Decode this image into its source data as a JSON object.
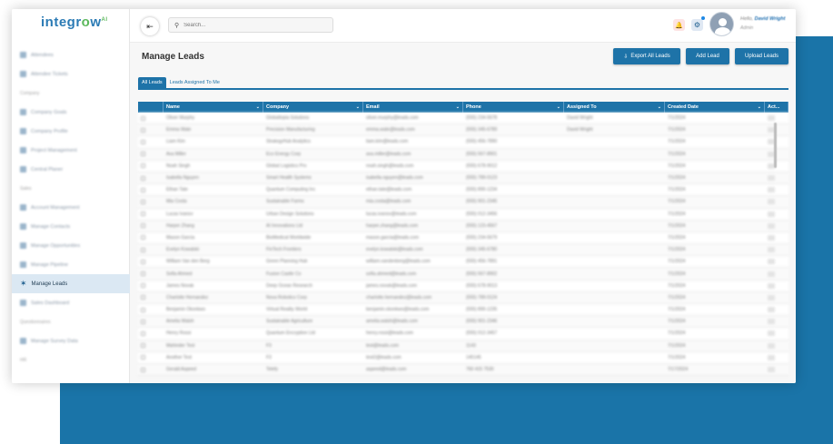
{
  "brand": {
    "logo_a": "integr",
    "logo_o": "o",
    "logo_b": "w",
    "logo_sup": "AI"
  },
  "sidebar": {
    "items": [
      {
        "type": "item",
        "label": "Attendees"
      },
      {
        "type": "item",
        "label": "Attendee Tickets"
      },
      {
        "type": "head",
        "label": "Company"
      },
      {
        "type": "item",
        "label": "Company Goals"
      },
      {
        "type": "item",
        "label": "Company Profile"
      },
      {
        "type": "item",
        "label": "Project Management"
      },
      {
        "type": "item",
        "label": "Central Planer"
      },
      {
        "type": "head",
        "label": "Sales"
      },
      {
        "type": "item",
        "label": "Account Management"
      },
      {
        "type": "item",
        "label": "Manage Contacts"
      },
      {
        "type": "item",
        "label": "Manage Opportunities"
      },
      {
        "type": "item",
        "label": "Manage Pipeline"
      },
      {
        "type": "active",
        "label": "Manage Leads"
      },
      {
        "type": "item",
        "label": "Sales Dashboard"
      },
      {
        "type": "head",
        "label": "Questionnaires"
      },
      {
        "type": "item",
        "label": "Manage Survey Data"
      },
      {
        "type": "head",
        "label": "HR"
      }
    ]
  },
  "topbar": {
    "search_placeholder": "Search...",
    "greeting_prefix": "Hello,",
    "user_name": "David Wright",
    "user_role": "Admin"
  },
  "page": {
    "title": "Manage Leads",
    "export_label": "Export All Leads",
    "add_label": "Add Lead",
    "upload_label": "Upload Leads",
    "tabs": [
      "All Leads",
      "Leads Assigned To Me"
    ]
  },
  "table": {
    "columns": [
      "",
      "Name",
      "Company",
      "Email",
      "Phone",
      "Assigned To",
      "Created Date",
      "Act..."
    ],
    "rows": [
      [
        "Oliver Murphy",
        "Globaltopia Solutions",
        "oliver.murphy@leads.com",
        "(555) 234-5678",
        "David Wright",
        "7/1/2024"
      ],
      [
        "Emma Wate",
        "Precision Manufacturing",
        "emma.wate@leads.com",
        "(555) 345-6789",
        "David Wright",
        "7/1/2024"
      ],
      [
        "Liam Kim",
        "StrategyHub Analytics",
        "liam.kim@leads.com",
        "(555) 456-7890",
        "",
        "7/1/2024"
      ],
      [
        "Ava Miller",
        "Eco Energy Corp",
        "ava.miller@leads.com",
        "(555) 567-8901",
        "",
        "7/1/2024"
      ],
      [
        "Noah Singh",
        "Global Logistics Pro",
        "noah.singh@leads.com",
        "(555) 678-9012",
        "",
        "7/1/2024"
      ],
      [
        "Isabella Nguyen",
        "Smart Health Systems",
        "isabella.nguyen@leads.com",
        "(555) 789-0123",
        "",
        "7/1/2024"
      ],
      [
        "Ethan Tate",
        "Quantum Computing Inc",
        "ethan.tate@leads.com",
        "(555) 890-1234",
        "",
        "7/1/2024"
      ],
      [
        "Mia Costa",
        "Sustainable Farms",
        "mia.costa@leads.com",
        "(555) 901-2345",
        "",
        "7/1/2024"
      ],
      [
        "Lucas Ivanov",
        "Urban Design Solutions",
        "lucas.ivanov@leads.com",
        "(555) 012-3456",
        "",
        "7/1/2024"
      ],
      [
        "Harper Zhang",
        "AI Innovations Ltd",
        "harper.zhang@leads.com",
        "(555) 123-4567",
        "",
        "7/1/2024"
      ],
      [
        "Mason Garcia",
        "BioMedical Worldwide",
        "mason.garcia@leads.com",
        "(555) 234-5679",
        "",
        "7/1/2024"
      ],
      [
        "Evelyn Kowalski",
        "FinTech Frontiers",
        "evelyn.kowalski@leads.com",
        "(555) 345-6780",
        "",
        "7/1/2024"
      ],
      [
        "William Van den Berg",
        "Green Planning Hub",
        "william.vandenberg@leads.com",
        "(555) 456-7891",
        "",
        "7/1/2024"
      ],
      [
        "Sofia Ahmed",
        "Fusion Castle Co",
        "sofia.ahmed@leads.com",
        "(555) 567-8902",
        "",
        "7/1/2024"
      ],
      [
        "James Novak",
        "Deep Ocean Research",
        "james.novak@leads.com",
        "(555) 678-9013",
        "",
        "7/1/2024"
      ],
      [
        "Charlotte Hernandez",
        "Nova Robotics Corp",
        "charlotte.hernandez@leads.com",
        "(555) 789-0124",
        "",
        "7/1/2024"
      ],
      [
        "Benjamin Okonkwo",
        "Virtual Reality World",
        "benjamin.okonkwo@leads.com",
        "(555) 890-1235",
        "",
        "7/1/2024"
      ],
      [
        "Amelia Walsh",
        "Sustainable Agriculture",
        "amelia.walsh@leads.com",
        "(555) 901-2346",
        "",
        "7/1/2024"
      ],
      [
        "Henry Rossi",
        "Quantum Encryption Ltd",
        "henry.rossi@leads.com",
        "(555) 012-3457",
        "",
        "7/1/2024"
      ],
      [
        "Mahinder Test",
        "F3",
        "test@leads.com",
        "1143",
        "",
        "7/1/2024"
      ],
      [
        "Another Test",
        "F3",
        "test2@leads.com",
        "145145",
        "",
        "7/1/2024"
      ],
      [
        "Gerald Aspeed",
        "Telefy",
        "aspeed@leads.com",
        "760 415 7530",
        "",
        "7/17/2024"
      ]
    ]
  },
  "colors": {
    "primary": "#1e73a8",
    "backdrop": "#1a74a8",
    "active_nav": "#dbe8f3",
    "bell": "#e53935"
  }
}
